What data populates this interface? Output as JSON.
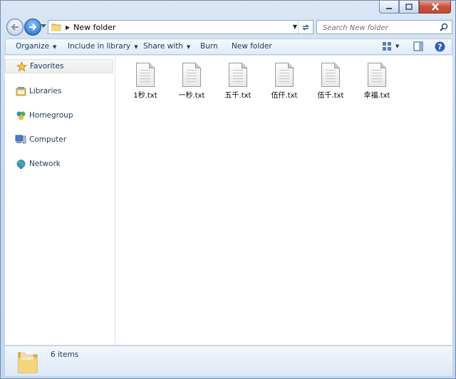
{
  "window": {
    "controls": [
      "minimize-icon",
      "maximize-icon",
      "close-icon"
    ]
  },
  "nav": {
    "address_crumb": "New folder",
    "search_placeholder": "Search New folder"
  },
  "toolbar": {
    "organize": "Organize",
    "include_in_library": "Include in library",
    "share_with": "Share with",
    "burn": "Burn",
    "new_folder": "New folder"
  },
  "sidebar": {
    "items": [
      {
        "label": "Favorites",
        "icon": "star-icon"
      },
      {
        "label": "Libraries",
        "icon": "libraries-icon"
      },
      {
        "label": "Homegroup",
        "icon": "homegroup-icon"
      },
      {
        "label": "Computer",
        "icon": "computer-icon"
      },
      {
        "label": "Network",
        "icon": "network-icon"
      }
    ]
  },
  "files": [
    {
      "name": "1秒.txt"
    },
    {
      "name": "一秒.txt"
    },
    {
      "name": "五千.txt"
    },
    {
      "name": "伍仟.txt"
    },
    {
      "name": "伍千.txt"
    },
    {
      "name": "幸福.txt"
    }
  ],
  "status": {
    "item_count": "6 items"
  },
  "colors": {
    "accent": "#1e395b",
    "close_button": "#c7503a",
    "window_frame": "#c9d9ef"
  }
}
